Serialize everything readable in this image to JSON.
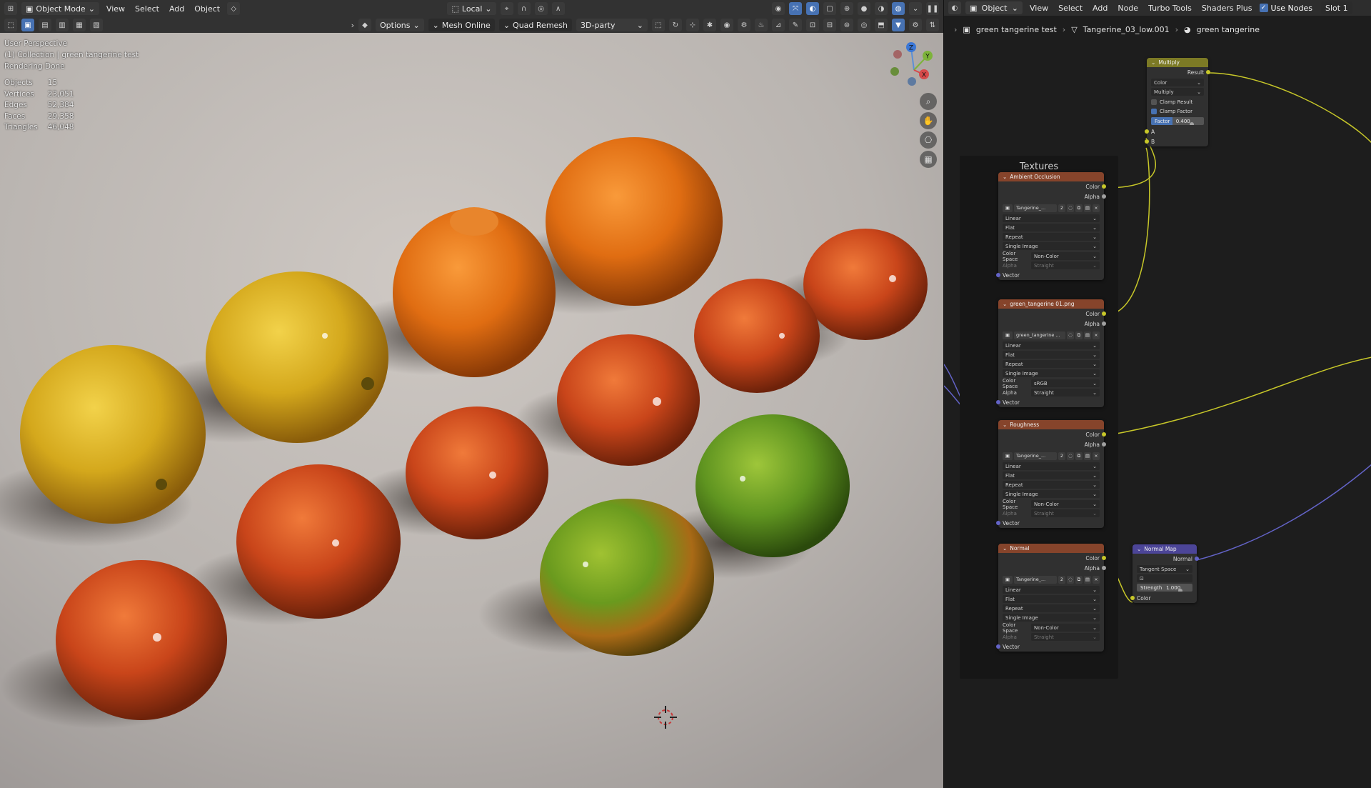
{
  "viewport": {
    "header": {
      "mode": "Object Mode",
      "menus": [
        "View",
        "Select",
        "Add",
        "Object"
      ],
      "orientation": "Local"
    },
    "tool_header": {
      "options": "Options",
      "mesh_online": "Mesh Online",
      "quad_remesh": "Quad Remesh",
      "party": "3D-party"
    },
    "overlay": {
      "perspective": "User Perspective",
      "collection": "(1) Collection | green tangerine test",
      "status": "Rendering Done"
    },
    "stats": [
      {
        "label": "Objects",
        "value": "15"
      },
      {
        "label": "Vertices",
        "value": "23,051"
      },
      {
        "label": "Edges",
        "value": "52,384"
      },
      {
        "label": "Faces",
        "value": "29,358"
      },
      {
        "label": "Triangles",
        "value": "46,048"
      }
    ],
    "gizmo": {
      "x": "X",
      "y": "Y",
      "z": "Z"
    }
  },
  "node_editor": {
    "header": {
      "editor_type": "Object",
      "menus": [
        "View",
        "Select",
        "Add",
        "Node",
        "Turbo Tools",
        "Shaders Plus"
      ],
      "use_nodes": "Use Nodes",
      "slot": "Slot 1"
    },
    "breadcrumb": [
      "green tangerine test",
      "Tangerine_03_low.001",
      "green tangerine"
    ],
    "frame_label": "Textures",
    "multiply": {
      "title": "Multiply",
      "result": "Result",
      "type": "Color",
      "blend": "Multiply",
      "clamp_result": "Clamp Result",
      "clamp_factor": "Clamp Factor",
      "factor_label": "Factor",
      "factor_value": "0.400",
      "factor": 0.4,
      "a": "A",
      "b": "B"
    },
    "tex_nodes": [
      {
        "title": "Ambient Occlusion",
        "image": "Tangerine_...",
        "users": "2",
        "interp": "Linear",
        "proj": "Flat",
        "ext": "Repeat",
        "src": "Single Image",
        "cs_label": "Color Space",
        "cs": "Non-Color",
        "alpha_label": "Alpha",
        "alpha": "Straight",
        "alpha_dim": true
      },
      {
        "title": "green_tangerine 01.png",
        "image": "green_tangerine ...",
        "users": "",
        "interp": "Linear",
        "proj": "Flat",
        "ext": "Repeat",
        "src": "Single Image",
        "cs_label": "Color Space",
        "cs": "sRGB",
        "alpha_label": "Alpha",
        "alpha": "Straight",
        "alpha_dim": false
      },
      {
        "title": "Roughness",
        "image": "Tangerine_...",
        "users": "2",
        "interp": "Linear",
        "proj": "Flat",
        "ext": "Repeat",
        "src": "Single Image",
        "cs_label": "Color Space",
        "cs": "Non-Color",
        "alpha_label": "Alpha",
        "alpha": "Straight",
        "alpha_dim": true
      },
      {
        "title": "Normal",
        "image": "Tangerine_...",
        "users": "2",
        "interp": "Linear",
        "proj": "Flat",
        "ext": "Repeat",
        "src": "Single Image",
        "cs_label": "Color Space",
        "cs": "Non-Color",
        "alpha_label": "Alpha",
        "alpha": "Straight",
        "alpha_dim": true
      }
    ],
    "sockets": {
      "color": "Color",
      "alpha": "Alpha",
      "vector": "Vector"
    },
    "normal_map": {
      "title": "Normal Map",
      "normal": "Normal",
      "space": "Tangent Space",
      "strength_label": "Strength",
      "strength_value": "1.000",
      "color": "Color"
    }
  }
}
